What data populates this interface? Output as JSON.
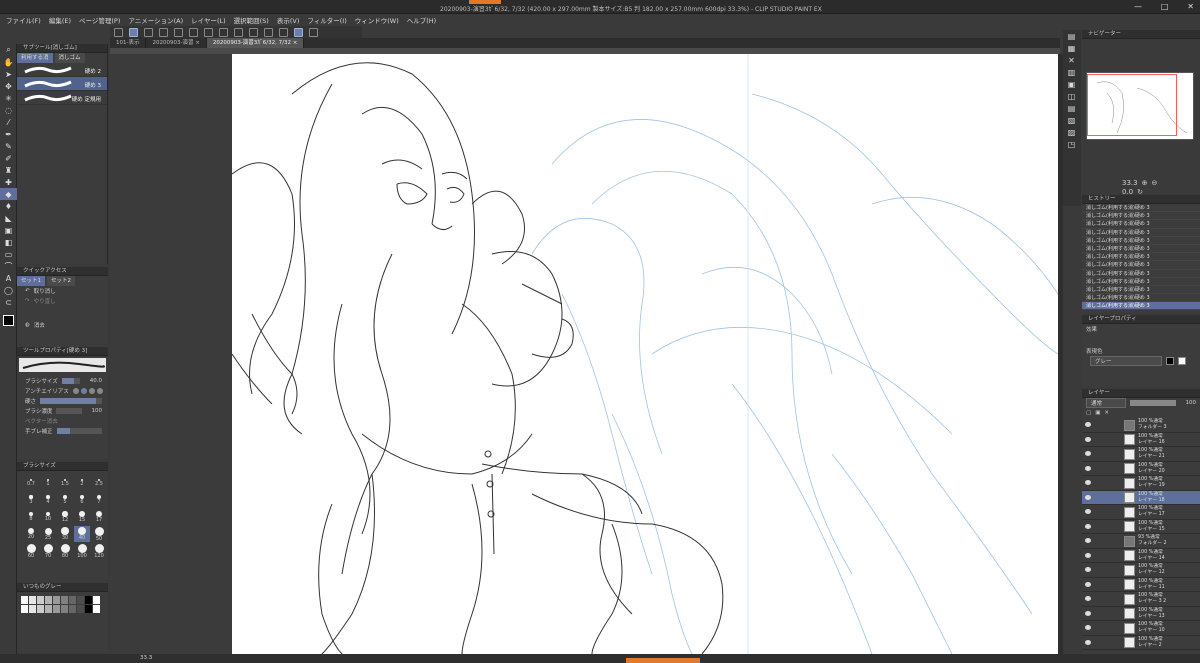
{
  "window": {
    "title": "20200903-演習3ｶﾞ6/32, 7/32 (420.00 x 297.00mm 製本サイズ:B5 判 182.00 x 257.00mm 600dpi 33.3%) - CLIP STUDIO PAINT EX",
    "controls": [
      "—",
      "□",
      "✕"
    ]
  },
  "menu": [
    "ファイル(F)",
    "編集(E)",
    "ページ管理(P)",
    "アニメーション(A)",
    "レイヤー(L)",
    "選択範囲(S)",
    "表示(V)",
    "フィルター(I)",
    "ウィンドウ(W)",
    "ヘルプ(H)"
  ],
  "tabs": [
    "101-表示",
    "20200903-演習 ×",
    "20200903-演習3ｶﾞ6/32, 7/32 ×"
  ],
  "subtool": {
    "header": "サブツール[消しゴム]",
    "tabs": [
      "利用する消",
      "消しゴム"
    ],
    "brushes": [
      "硬め 2",
      "硬め 3",
      "硬め 定規用"
    ],
    "selected_index": 1
  },
  "quick_access": {
    "header": "クイックアクセス",
    "tabs": [
      "セット1",
      "セット2"
    ],
    "items": [
      "取り消し",
      "やり直し",
      "消去"
    ]
  },
  "tool_property": {
    "header": "ツールプロパティ[硬め 3]",
    "brush_size_label": "ブラシサイズ",
    "brush_size_value": "40.0",
    "antialias_label": "アンチエイリアス",
    "hardness_label": "硬さ",
    "density_label": "ブラシ濃度",
    "density_value": "100",
    "vector_erase_label": "ベクター消去",
    "stabilization_label": "手ブレ補正"
  },
  "brush_size_panel": {
    "header": "ブラシサイズ",
    "sizes": [
      "0.7",
      "1",
      "1.5",
      "2",
      "2.5",
      "3",
      "4",
      "5",
      "6",
      "7",
      "8",
      "10",
      "12",
      "15",
      "17",
      "20",
      "25",
      "30",
      "40",
      "50",
      "60",
      "70",
      "80",
      "100",
      "120"
    ],
    "selected_size": "40"
  },
  "color_set": {
    "header": "いつものグレー"
  },
  "navigator": {
    "header": "ナビゲーター",
    "zoom": "33.3",
    "angle": "0.0"
  },
  "history": {
    "header": "ヒストリー",
    "items": [
      "消しゴム(利用する消)硬め 3",
      "消しゴム(利用する消)硬め 3",
      "消しゴム(利用する消)硬め 3",
      "消しゴム(利用する消)硬め 3",
      "消しゴム(利用する消)硬め 3",
      "消しゴム(利用する消)硬め 3",
      "消しゴム(利用する消)硬め 3",
      "消しゴム(利用する消)硬め 3",
      "消しゴム(利用する消)硬め 3",
      "消しゴム(利用する消)硬め 3",
      "消しゴム(利用する消)硬め 3",
      "消しゴム(利用する消)硬め 3",
      "消しゴム(利用する消)硬め 3"
    ]
  },
  "layer_property": {
    "header": "レイヤープロパティ",
    "effect_label": "効果",
    "color_label": "表現色",
    "color_value": "グレー"
  },
  "layers": {
    "header": "レイヤー",
    "blend_mode": "通常",
    "opacity": "100",
    "rows": [
      {
        "l1": "100 %通常",
        "l2": "フォルダー 3",
        "folder": true
      },
      {
        "l1": "100 %通常",
        "l2": "レイヤー 16",
        "folder": false
      },
      {
        "l1": "100 %通常",
        "l2": "レイヤー 21",
        "folder": false
      },
      {
        "l1": "100 %通常",
        "l2": "レイヤー 20",
        "folder": false
      },
      {
        "l1": "100 %通常",
        "l2": "レイヤー 19",
        "folder": false
      },
      {
        "l1": "100 %通常",
        "l2": "レイヤー 18",
        "folder": false,
        "selected": true
      },
      {
        "l1": "100 %通常",
        "l2": "レイヤー 17",
        "folder": false
      },
      {
        "l1": "100 %通常",
        "l2": "レイヤー 15",
        "folder": false
      },
      {
        "l1": "93 %通常",
        "l2": "フォルダー 2",
        "folder": true
      },
      {
        "l1": "100 %通常",
        "l2": "レイヤー 14",
        "folder": false
      },
      {
        "l1": "100 %通常",
        "l2": "レイヤー 12",
        "folder": false
      },
      {
        "l1": "100 %通常",
        "l2": "レイヤー 11",
        "folder": false
      },
      {
        "l1": "100 %通常",
        "l2": "レイヤー 3 2",
        "folder": false
      },
      {
        "l1": "100 %通常",
        "l2": "レイヤー 13",
        "folder": false
      },
      {
        "l1": "100 %通常",
        "l2": "レイヤー 10",
        "folder": false
      },
      {
        "l1": "100 %通常",
        "l2": "レイヤー 2",
        "folder": false
      }
    ]
  },
  "status": {
    "zoom": "33.3"
  }
}
